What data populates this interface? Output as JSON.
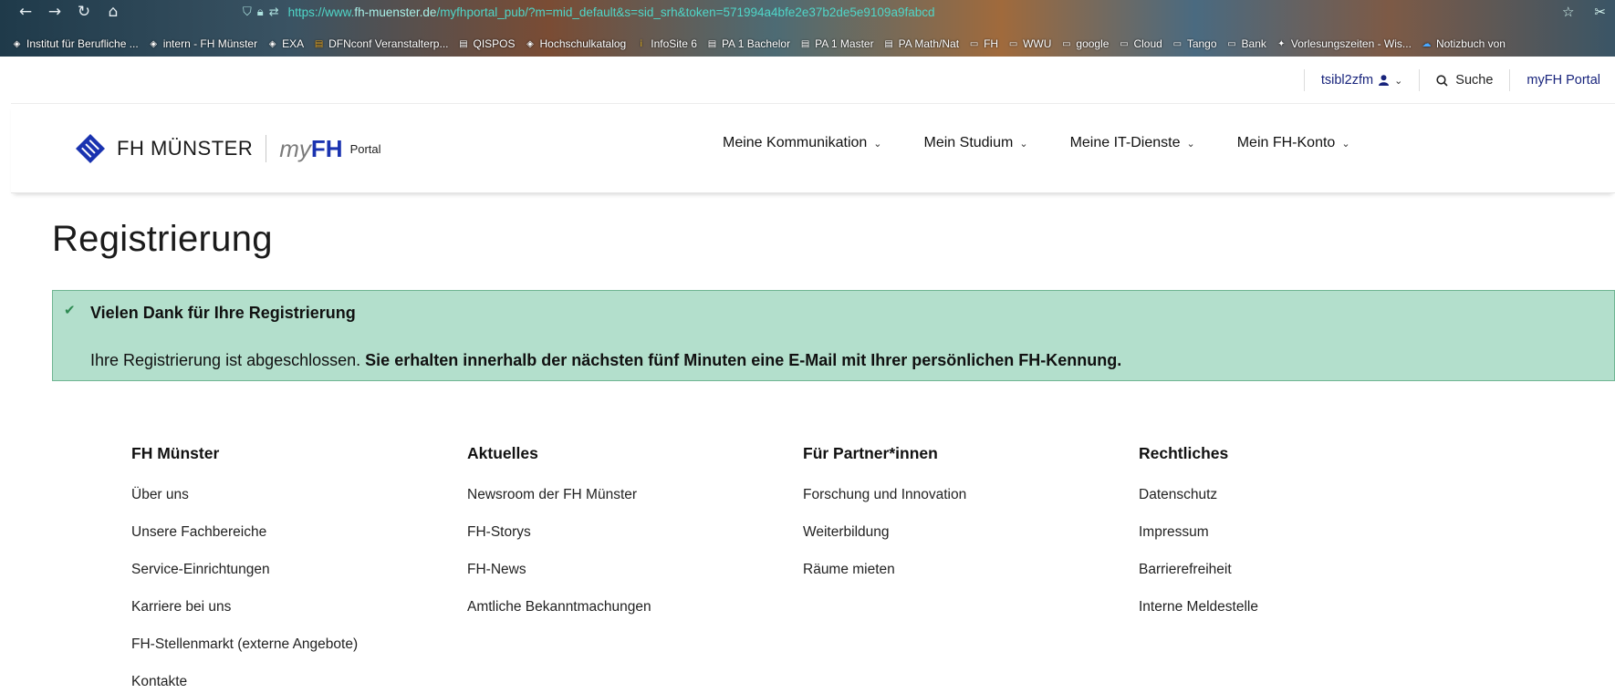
{
  "browser": {
    "url_prefix": "https://www.",
    "url_domain": "fh-muenster.de",
    "url_rest": "/myfhportal_pub/?m=mid_default&s=sid_srh&token=571994a4bfe2e37b2de5e9109a9fabcd",
    "bookmarks": [
      {
        "label": "Institut für Berufliche ...",
        "icon": "fh-logo-icon",
        "color": "#ffffff"
      },
      {
        "label": "intern - FH Münster",
        "icon": "fh-logo-icon",
        "color": "#ffffff"
      },
      {
        "label": "EXA",
        "icon": "fh-logo-icon",
        "color": "#ffffff"
      },
      {
        "label": "DFNconf Veranstalterp...",
        "icon": "flag-icon",
        "color": "#e0a020"
      },
      {
        "label": "QISPOS",
        "icon": "doc-icon",
        "color": "#ffffff"
      },
      {
        "label": "Hochschulkatalog",
        "icon": "fh-logo-icon",
        "color": "#ffffff"
      },
      {
        "label": "InfoSite 6",
        "icon": "info-icon",
        "color": "#e0b020"
      },
      {
        "label": "PA 1 Bachelor",
        "icon": "doc-icon",
        "color": "#ffffff"
      },
      {
        "label": "PA 1 Master",
        "icon": "doc-icon",
        "color": "#ffffff"
      },
      {
        "label": "PA Math/Nat",
        "icon": "doc-icon",
        "color": "#ffffff"
      },
      {
        "label": "FH",
        "icon": "folder-icon",
        "color": "#ffffff"
      },
      {
        "label": "WWU",
        "icon": "folder-icon",
        "color": "#ffffff"
      },
      {
        "label": "google",
        "icon": "folder-icon",
        "color": "#ffffff"
      },
      {
        "label": "Cloud",
        "icon": "folder-icon",
        "color": "#ffffff"
      },
      {
        "label": "Tango",
        "icon": "folder-icon",
        "color": "#ffffff"
      },
      {
        "label": "Bank",
        "icon": "folder-icon",
        "color": "#ffffff"
      },
      {
        "label": "Vorlesungszeiten - Wis...",
        "icon": "wiki-icon",
        "color": "#ffffff"
      },
      {
        "label": "Notizbuch von",
        "icon": "cloud-icon",
        "color": "#4aa8ff"
      }
    ]
  },
  "utility": {
    "username": "tsibl2zfm",
    "search_label": "Suche",
    "portal_label": "myFH Portal"
  },
  "header": {
    "logo_text": "FH MÜNSTER",
    "logo_my": "my",
    "logo_fh": "FH",
    "logo_portal": "Portal",
    "menu": [
      {
        "label": "Meine Kommunikation"
      },
      {
        "label": "Mein Studium"
      },
      {
        "label": "Meine IT-Dienste"
      },
      {
        "label": "Mein FH-Konto"
      }
    ]
  },
  "content": {
    "title": "Registrierung",
    "alert_title": "Vielen Dank für Ihre Registrierung",
    "alert_text_plain": "Ihre Registrierung ist abgeschlossen. ",
    "alert_text_bold": "Sie erhalten innerhalb der nächsten fünf Minuten eine E-Mail mit Ihrer persönlichen FH-Kennung."
  },
  "footer": {
    "columns": [
      {
        "heading": "FH Münster",
        "links": [
          "Über uns",
          "Unsere Fachbereiche",
          "Service-Einrichtungen",
          "Karriere bei uns",
          "FH-Stellenmarkt (externe Angebote)",
          "Kontakte"
        ]
      },
      {
        "heading": "Aktuelles",
        "links": [
          "Newsroom der FH Münster",
          "FH-Storys",
          "FH-News",
          "Amtliche Bekanntmachungen"
        ]
      },
      {
        "heading": "Für Partner*innen",
        "links": [
          "Forschung und Innovation",
          "Weiterbildung",
          "Räume mieten"
        ]
      },
      {
        "heading": "Rechtliches",
        "links": [
          "Datenschutz",
          "Impressum",
          "Barrierefreiheit",
          "Interne Meldestelle"
        ]
      }
    ]
  },
  "colors": {
    "brand_blue": "#1a33b0",
    "alert_bg": "#b3dfcc",
    "alert_border": "#6fb592"
  }
}
